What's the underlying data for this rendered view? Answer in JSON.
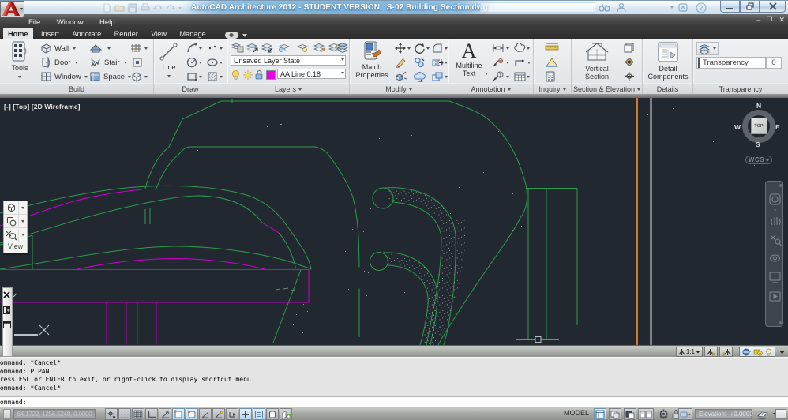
{
  "titlebar": {
    "title": "AutoCAD Architecture 2012 - STUDENT VERSION",
    "doc_name": "S-02 Building Section.dwg"
  },
  "menubar": {
    "items": [
      {
        "label": "File"
      },
      {
        "label": "Window"
      },
      {
        "label": "Help"
      }
    ]
  },
  "tabs": [
    {
      "label": "Home"
    },
    {
      "label": "Insert"
    },
    {
      "label": "Annotate"
    },
    {
      "label": "Render"
    },
    {
      "label": "View"
    },
    {
      "label": "Manage"
    }
  ],
  "ribbon": {
    "build": {
      "label": "Build",
      "tools": "Tools",
      "wall": "Wall",
      "door": "Door",
      "window": "Window",
      "stair": "Stair",
      "space": "Space"
    },
    "draw": {
      "label": "Draw",
      "line": "Line"
    },
    "layers": {
      "label": "Layers",
      "state": "Unsaved Layer State",
      "current": "AA Line 0.18"
    },
    "modify": {
      "label": "Modify",
      "match1": "Match",
      "match2": "Properties"
    },
    "annotation": {
      "label": "Annotation",
      "mtext1": "Multiline",
      "mtext2": "Text"
    },
    "inquiry": {
      "label": "Inquiry"
    },
    "section": {
      "label": "Section & Elevation",
      "big1": "Vertical",
      "big2": "Section"
    },
    "details": {
      "label": "Details",
      "big1": "Detail",
      "big2": "Components"
    },
    "transparency": {
      "label": "Transparency",
      "slider_label": "Transparency",
      "value": "0"
    }
  },
  "canvas": {
    "viewport_label": "[-] [Top] [2D Wireframe]",
    "view_toolbar": "View",
    "viewcube": {
      "n": "N",
      "e": "E",
      "s": "S",
      "w": "W",
      "top": "TOP",
      "wcs": "WCS"
    }
  },
  "drawing_status": {
    "annotation_scale": "1:1"
  },
  "command": {
    "history": [
      {
        "text": "Command: *Cancel*"
      },
      {
        "text": "Command: P PAN"
      },
      {
        "text": "Press ESC or ENTER to exit, or right-click to display shortcut menu."
      },
      {
        "text": "Command: *Cancel*"
      }
    ],
    "prompt": "Command:"
  },
  "statusbar": {
    "coords": "64.1722, 1256.5248, 0.0000",
    "model": "MODEL",
    "elevation_label": "Elevation:",
    "elevation_value": "+0.0000"
  },
  "colors": {
    "canvas_bg": "#212830",
    "line_green": "#2e9b4e",
    "line_magenta": "#cc00cc",
    "line_orange": "#d2772a",
    "pressed_blue": "#bcd8ee"
  }
}
